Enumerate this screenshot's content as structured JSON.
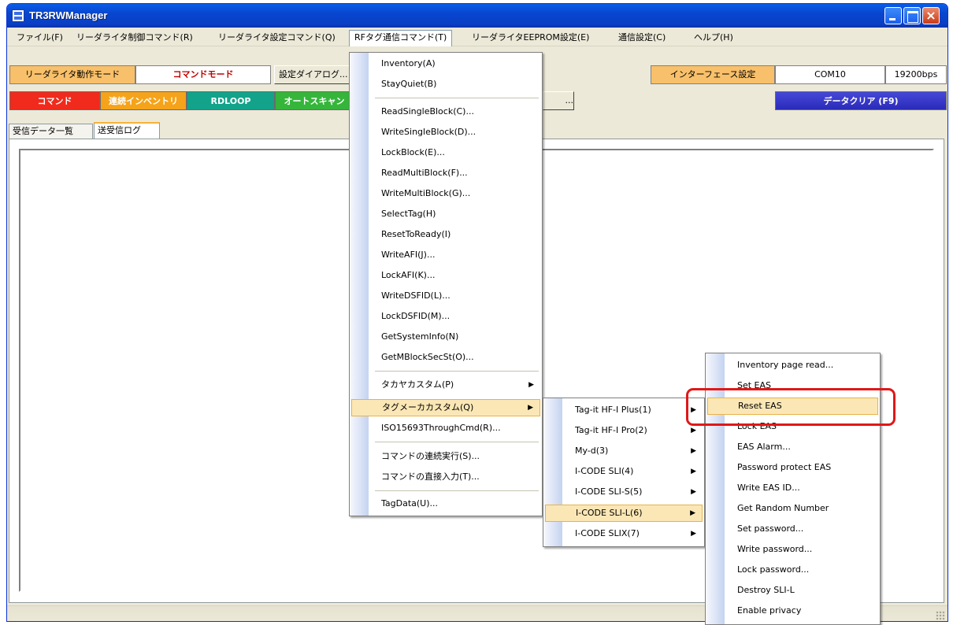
{
  "window": {
    "title": "TR3RWManager"
  },
  "menubar": {
    "items": [
      "ファイル(F)",
      "リーダライタ制御コマンド(R)",
      "リーダライタ設定コマンド(Q)",
      "RFタグ通信コマンド(T)",
      "リーダライタEEPROM設定(E)",
      "通信設定(C)",
      "ヘルプ(H)"
    ]
  },
  "toolbar": {
    "mode_label": "リーダライタ動作モード",
    "mode_value": "コマンドモード",
    "settings_dialog": "設定ダイアログ...",
    "interface_label": "インターフェース設定",
    "port": "COM10",
    "baud": "19200bps",
    "cmd_buttons": [
      "コマンド",
      "連続インベントリ",
      "RDLOOP",
      "オートスキャン"
    ],
    "small_button": "...",
    "data_clear": "データクリア (F9)"
  },
  "tabs": [
    "受信データ一覧",
    "送受信ログ"
  ],
  "menu_rf": {
    "items": [
      "Inventory(A)",
      "StayQuiet(B)",
      "ReadSingleBlock(C)...",
      "WriteSingleBlock(D)...",
      "LockBlock(E)...",
      "ReadMultiBlock(F)...",
      "WriteMultiBlock(G)...",
      "SelectTag(H)",
      "ResetToReady(I)",
      "WriteAFI(J)...",
      "LockAFI(K)...",
      "WriteDSFID(L)...",
      "LockDSFID(M)...",
      "GetSystemInfo(N)",
      "GetMBlockSecSt(O)...",
      "タカヤカスタム(P)",
      "タグメーカカスタム(Q)",
      "ISO15693ThroughCmd(R)...",
      "コマンドの連続実行(S)...",
      "コマンドの直接入力(T)...",
      "TagData(U)..."
    ]
  },
  "menu_maker": {
    "items": [
      "Tag-it HF-I Plus(1)",
      "Tag-it HF-I Pro(2)",
      "My-d(3)",
      "I-CODE SLI(4)",
      "I-CODE SLI-S(5)",
      "I-CODE SLI-L(6)",
      "I-CODE SLIX(7)"
    ]
  },
  "menu_slil": {
    "items": [
      "Inventory page read...",
      "Set EAS",
      "Reset EAS",
      "Lock EAS",
      "EAS Alarm...",
      "Password protect EAS",
      "Write EAS ID...",
      "Get Random Number",
      "Set password...",
      "Write password...",
      "Lock password...",
      "Destroy SLI-L",
      "Enable privacy"
    ]
  },
  "colors": {
    "cmd_red": "#f02a1c",
    "cmd_orange": "#f5a31a",
    "cmd_teal": "#12a38a",
    "cmd_green": "#36b53b",
    "clear_blue": "#2a2bb8",
    "highlight_red": "#e01818"
  }
}
